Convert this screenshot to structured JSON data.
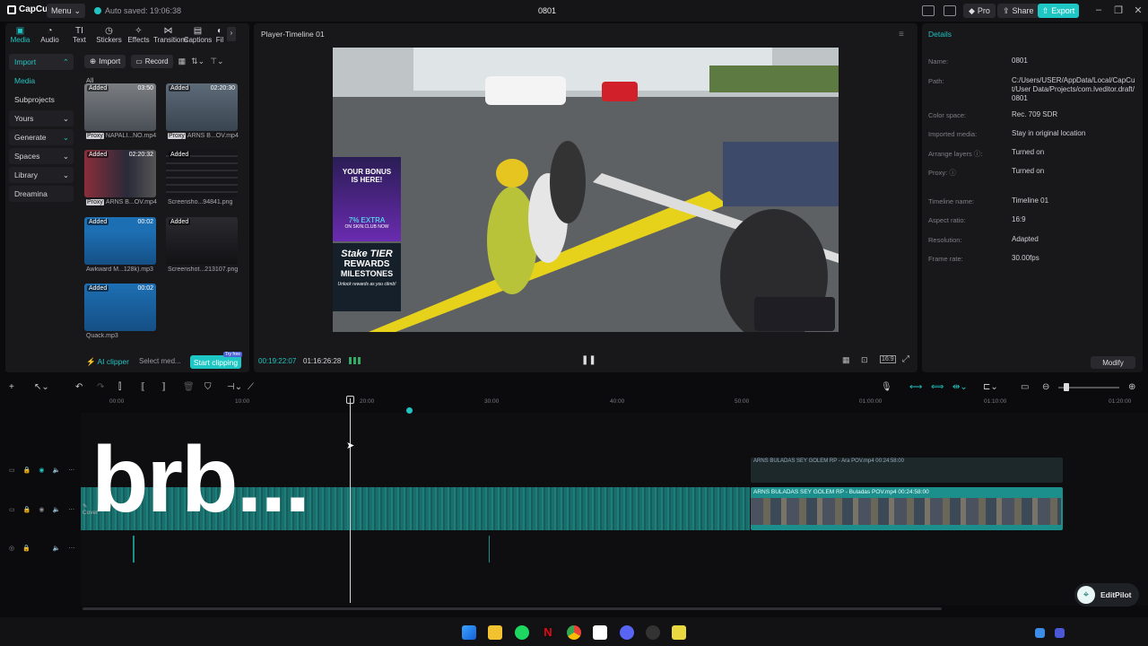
{
  "titlebar": {
    "app_name": "CapCut",
    "menu_label": "Menu",
    "autosave": "Auto saved: 19:06:38",
    "project_title": "0801",
    "pro_label": "Pro",
    "share_label": "Share",
    "export_label": "Export"
  },
  "tool_tabs": [
    {
      "label": "Media",
      "icon": "media-icon"
    },
    {
      "label": "Audio",
      "icon": "audio-icon"
    },
    {
      "label": "Text",
      "icon": "text-icon"
    },
    {
      "label": "Stickers",
      "icon": "sticker-icon"
    },
    {
      "label": "Effects",
      "icon": "effects-icon"
    },
    {
      "label": "Transitions",
      "icon": "transitions-icon"
    },
    {
      "label": "Captions",
      "icon": "captions-icon"
    },
    {
      "label": "Fil",
      "icon": "filter-icon"
    }
  ],
  "left_nav": {
    "import": "Import",
    "media": "Media",
    "subprojects": "Subprojects",
    "yours": "Yours",
    "generate": "Generate",
    "spaces": "Spaces",
    "library": "Library",
    "dreamina": "Dreamina"
  },
  "media_toolbar": {
    "import_label": "Import",
    "record_label": "Record",
    "all_label": "All"
  },
  "media_items": [
    {
      "added": "Added",
      "duration": "03:50",
      "name": "NAPALI...NO.mp4",
      "proxy": "Proxy"
    },
    {
      "added": "Added",
      "duration": "02:20:30",
      "name": "ARNS B...OV.mp4",
      "proxy": "Proxy"
    },
    {
      "added": "Added",
      "duration": "02:20:32",
      "name": "ARNS B...OV.mp4",
      "proxy": "Proxy"
    },
    {
      "added": "Added",
      "duration": "",
      "name": "Screensho...94841.png",
      "proxy": ""
    },
    {
      "added": "Added",
      "duration": "00:02",
      "name": "Awkward M...128k).mp3",
      "proxy": ""
    },
    {
      "added": "Added",
      "duration": "",
      "name": "Screenshot...213107.png",
      "proxy": ""
    },
    {
      "added": "Added",
      "duration": "00:02",
      "name": "Quack.mp3",
      "proxy": ""
    }
  ],
  "ai_bar": {
    "ai_clipper": "AI clipper",
    "select_media": "Select med...",
    "start_clipping": "Start clipping",
    "try_free": "Try free"
  },
  "player": {
    "title": "Player-Timeline 01",
    "current_time": "00:19:22:07",
    "total_time": "01:16:26:28"
  },
  "details": {
    "title": "Details",
    "rows": [
      {
        "label": "Name:",
        "value": "0801"
      },
      {
        "label": "Path:",
        "value": "C:/Users/USER/AppData/Local/CapCut/User Data/Projects/com.lveditor.draft/0801"
      },
      {
        "label": "Color space:",
        "value": "Rec. 709 SDR"
      },
      {
        "label": "Imported media:",
        "value": "Stay in original location"
      },
      {
        "label": "Arrange layers",
        "value": "Turned on"
      },
      {
        "label": "Proxy:",
        "value": "Turned on"
      },
      {
        "label": "Timeline name:",
        "value": "Timeline 01"
      },
      {
        "label": "Aspect ratio:",
        "value": "16:9"
      },
      {
        "label": "Resolution:",
        "value": "Adapted"
      },
      {
        "label": "Frame rate:",
        "value": "30.00fps"
      }
    ],
    "modify_label": "Modify"
  },
  "timeline": {
    "ruler": [
      "00:00",
      "10:00",
      "20:00",
      "30:00",
      "40:00",
      "50:00",
      "01:00:00",
      "01:10:00",
      "01:20:00"
    ],
    "overlay_clip_label": "ARNS BULADAS SEY GOLEM RP - Ara POV.mp4  00:24:58:00",
    "main_clip_label": "ARNS BULADAS SEY GOLEM RP - Buladas  POV.mp4  00:24:58:00",
    "brb_text": "brb...",
    "cover_label": "Cover"
  },
  "video_overlay": {
    "bonus_line1": "YOUR BONUS",
    "bonus_line2": "IS HERE!",
    "bonus_extra": "7% EXTRA",
    "bonus_site": "ON SKIN.CLUB NOW",
    "stake_line1": "Stake TIER",
    "stake_line2": "REWARDS",
    "stake_line3": "MILESTONES",
    "stake_sub": "Unlock rewards as you climb!"
  },
  "editpilot_label": "EditPilot",
  "colors": {
    "accent": "#22c3c0",
    "panel": "#18181b",
    "track": "#1c8f8c"
  }
}
